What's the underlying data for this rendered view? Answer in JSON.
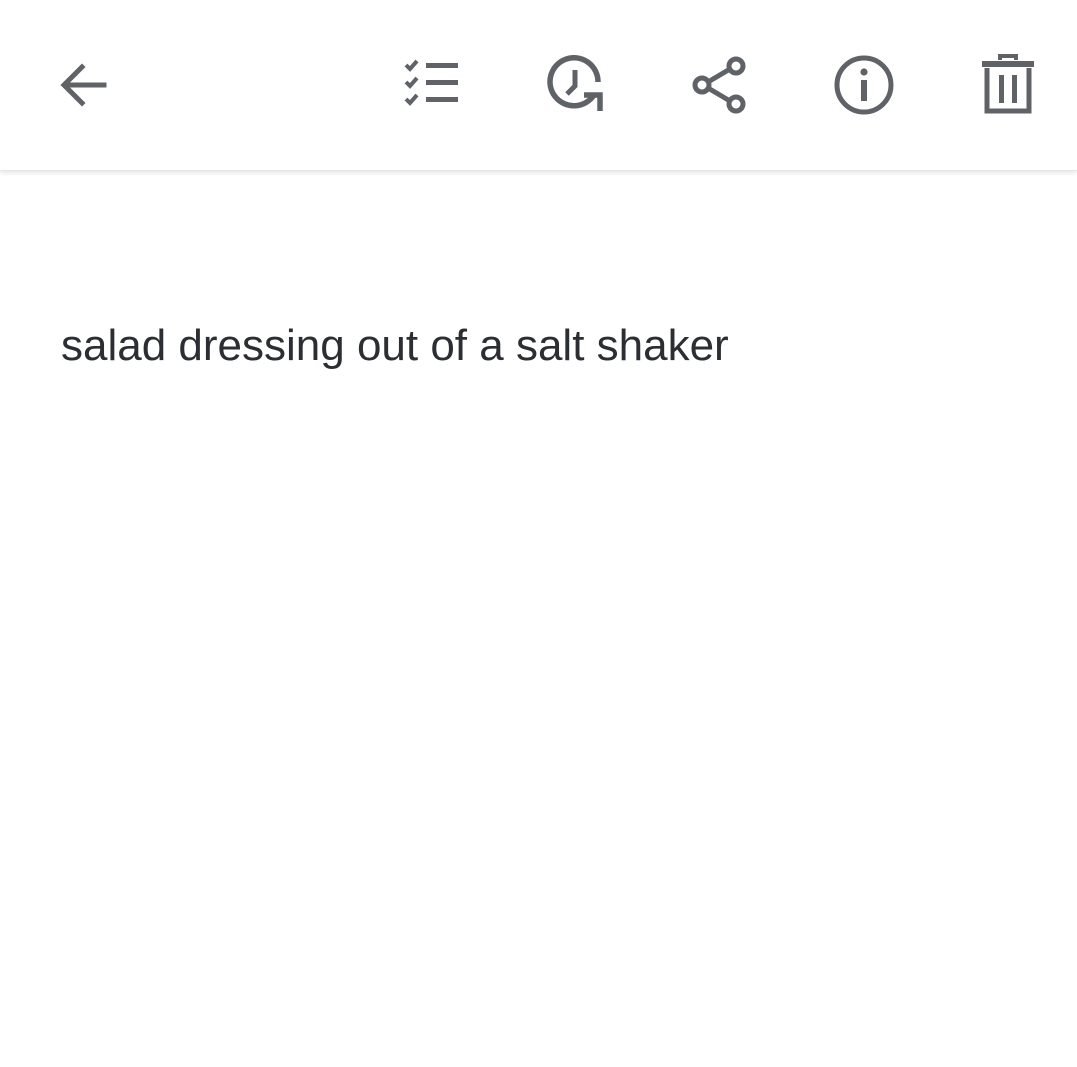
{
  "toolbar": {
    "icons": {
      "back": "arrow-back-icon",
      "checklist": "checklist-icon",
      "reminder": "reminder-clock-icon",
      "share": "share-icon",
      "info": "info-icon",
      "delete": "trash-icon"
    },
    "icon_color": "#5f6368"
  },
  "note": {
    "text": "salad dressing out of a salt shaker"
  },
  "colors": {
    "background": "#ffffff",
    "text": "#2b2f33"
  }
}
